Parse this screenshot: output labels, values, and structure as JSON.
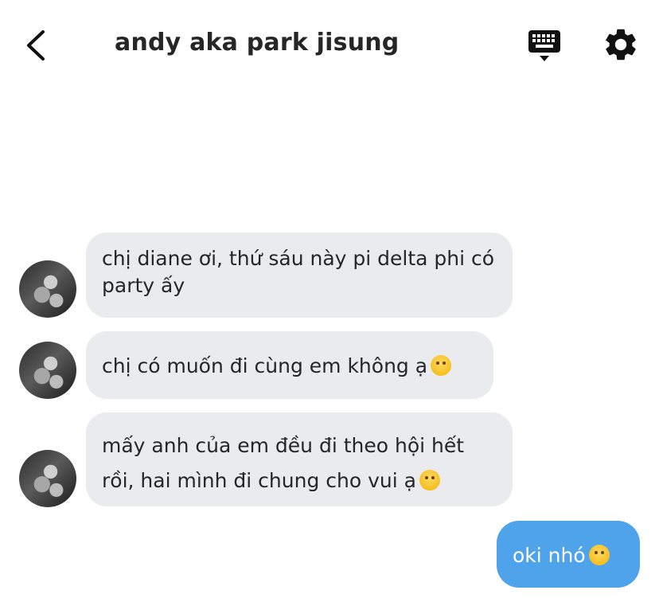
{
  "header": {
    "title": "andy aka park jisung"
  },
  "messages": [
    {
      "sender": "them",
      "text": "chị diane ơi, thứ sáu này pi delta phi có party ấy"
    },
    {
      "sender": "them",
      "text": "chị có muốn đi cùng em không ạ",
      "emoji": "kissing-face-icon"
    },
    {
      "sender": "them",
      "text": "mấy anh của em đều đi theo hội hết rồi, hai mình đi chung cho vui ạ",
      "emoji": "yum-face-icon"
    },
    {
      "sender": "me",
      "text": "oki nhó",
      "emoji": "grinning-face-icon"
    }
  ]
}
